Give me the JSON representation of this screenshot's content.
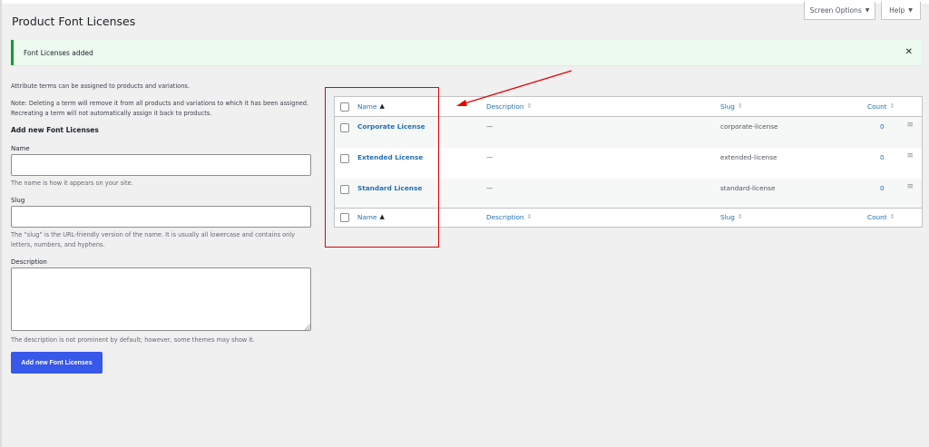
{
  "header": {
    "title": "Product Font Licenses",
    "screen_options_label": "Screen Options",
    "help_label": "Help"
  },
  "notice": {
    "message": "Font Licenses added",
    "dismiss_icon": "close-icon"
  },
  "intro": {
    "line1": "Attribute terms can be assigned to products and variations.",
    "line2": "Note: Deleting a term will remove it from all products and variations to which it has been assigned. Recreating a term will not automatically assign it back to products."
  },
  "form": {
    "title": "Add new Font Licenses",
    "name_label": "Name",
    "name_value": "",
    "name_help": "The name is how it appears on your site.",
    "slug_label": "Slug",
    "slug_value": "",
    "slug_help": "The “slug” is the URL-friendly version of the name. It is usually all lowercase and contains only letters, numbers, and hyphens.",
    "description_label": "Description",
    "description_value": "",
    "description_help": "The description is not prominent by default; however, some themes may show it.",
    "submit_label": "Add new Font Licenses"
  },
  "table": {
    "columns": {
      "name": "Name",
      "description": "Description",
      "slug": "Slug",
      "count": "Count"
    },
    "rows": [
      {
        "name": "Corporate License",
        "description": "—",
        "slug": "corporate-license",
        "count": "0"
      },
      {
        "name": "Extended License",
        "description": "—",
        "slug": "extended-license",
        "count": "0"
      },
      {
        "name": "Standard License",
        "description": "—",
        "slug": "standard-license",
        "count": "0"
      }
    ],
    "drag_icon": "≡"
  },
  "annotation": {
    "box_color": "#e60000",
    "arrow_color": "#e60000"
  }
}
